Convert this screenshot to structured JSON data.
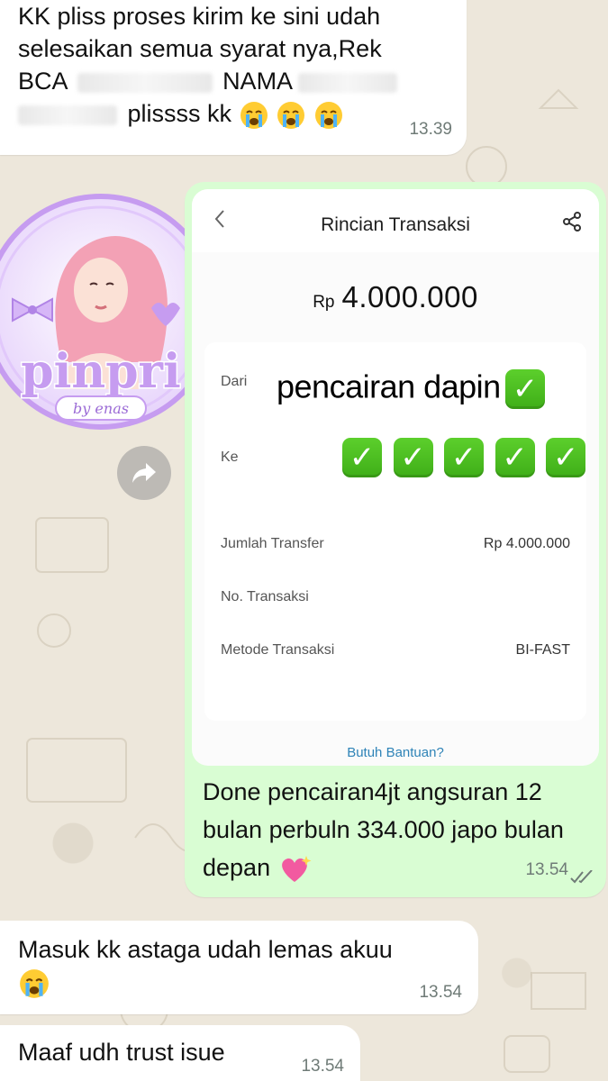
{
  "messages": {
    "top": {
      "line1": "KK pliss proses kirim ke sini udah",
      "line2": "selesaikan semua syarat nya,Rek",
      "line3_a": "BCA",
      "line3_b": "NAMA",
      "line4": "plissss kk",
      "time": "13.39"
    },
    "receipt": {
      "caption": "Done pencairan4jt angsuran 12 bulan perbuln 334.000 japo bulan depan",
      "time": "13.54",
      "status_icon": "double-check-icon"
    },
    "masuk": {
      "text": "Masuk kk astaga udah lemas akuu",
      "time": "13.54"
    },
    "maaf": {
      "text": "Maaf udh trust isue",
      "time": "13.54"
    }
  },
  "receipt_card": {
    "title": "Rincian Transaksi",
    "currency": "Rp",
    "amount": "4.000.000",
    "dari_label": "Dari",
    "sticker_text": "pencairan dapin",
    "ke_label": "Ke",
    "rows": [
      {
        "label": "Jumlah Transfer",
        "value": "Rp 4.000.000"
      },
      {
        "label": "No. Transaksi",
        "value": ""
      },
      {
        "label": "Metode Transaksi",
        "value": "BI-FAST"
      }
    ],
    "help": "Butuh Bantuan?"
  },
  "sticker": {
    "brand": "pinpri",
    "sub": "by enas"
  },
  "colors": {
    "incoming_bubble": "#ffffff",
    "outgoing_bubble": "#d9fdd3",
    "check_green": "#4cbc22",
    "link_blue": "#2e83b7",
    "sticker_purple": "#c69cf0"
  }
}
